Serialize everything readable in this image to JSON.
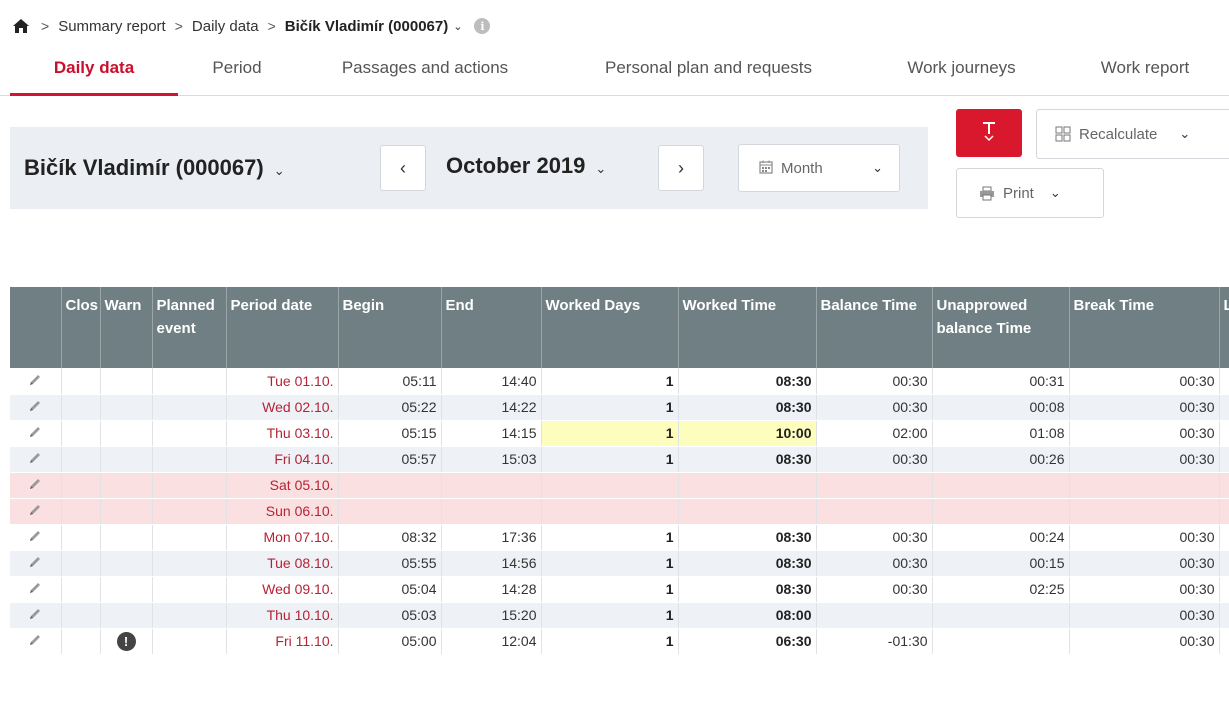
{
  "breadcrumb": {
    "items": [
      "Summary report",
      "Daily data"
    ],
    "current": "Bičík Vladimír (000067)",
    "info_glyph": "i"
  },
  "tabs": [
    {
      "label": "Daily data",
      "active": true
    },
    {
      "label": "Period",
      "active": false
    },
    {
      "label": "Passages and actions",
      "active": false
    },
    {
      "label": "Personal plan and requests",
      "active": false
    },
    {
      "label": "Work journeys",
      "active": false
    },
    {
      "label": "Work report",
      "active": false
    }
  ],
  "selector": {
    "employee": "Bičík Vladimír (000067)",
    "month": "October 2019",
    "period_type": "Month"
  },
  "toolbar": {
    "recalculate_label": "Recalculate",
    "print_label": "Print"
  },
  "colors": {
    "accent": "#d9182e",
    "header_bg": "#707f83",
    "date_text": "#b52335",
    "weekend_row": "#fbe0e2",
    "highlight": "#fdfdbd"
  },
  "icons": {
    "home": "home-icon",
    "info": "info-icon",
    "text_tool": "text-tool-icon",
    "recalculate": "grid-icon",
    "print": "printer-icon",
    "calendar": "calendar-icon",
    "edit": "pencil-icon",
    "warning": "exclamation-icon"
  },
  "table": {
    "columns": {
      "edit": "",
      "close": "Clos",
      "warn": "Warn",
      "planned": "Planned event",
      "date": "Period date",
      "begin": "Begin",
      "end": "End",
      "worked_days": "Worked Days",
      "worked_time": "Worked Time",
      "balance": "Balance Time",
      "unapproved": "Unapprowed balance Time",
      "break": "Break Time",
      "extra": "L"
    },
    "rows": [
      {
        "date": "Tue 01.10.",
        "begin": "05:11",
        "end": "14:40",
        "worked_days": "1",
        "worked_time": "08:30",
        "balance": "00:30",
        "unapproved": "00:31",
        "break": "00:30",
        "weekend": false,
        "highlight": false,
        "warning": ""
      },
      {
        "date": "Wed 02.10.",
        "begin": "05:22",
        "end": "14:22",
        "worked_days": "1",
        "worked_time": "08:30",
        "balance": "00:30",
        "unapproved": "00:08",
        "break": "00:30",
        "weekend": false,
        "highlight": false,
        "warning": ""
      },
      {
        "date": "Thu 03.10.",
        "begin": "05:15",
        "end": "14:15",
        "worked_days": "1",
        "worked_time": "10:00",
        "balance": "02:00",
        "unapproved": "01:08",
        "break": "00:30",
        "weekend": false,
        "highlight": true,
        "warning": ""
      },
      {
        "date": "Fri 04.10.",
        "begin": "05:57",
        "end": "15:03",
        "worked_days": "1",
        "worked_time": "08:30",
        "balance": "00:30",
        "unapproved": "00:26",
        "break": "00:30",
        "weekend": false,
        "highlight": false,
        "warning": ""
      },
      {
        "date": "Sat 05.10.",
        "begin": "",
        "end": "",
        "worked_days": "",
        "worked_time": "",
        "balance": "",
        "unapproved": "",
        "break": "",
        "weekend": true,
        "highlight": false,
        "warning": ""
      },
      {
        "date": "Sun 06.10.",
        "begin": "",
        "end": "",
        "worked_days": "",
        "worked_time": "",
        "balance": "",
        "unapproved": "",
        "break": "",
        "weekend": true,
        "highlight": false,
        "warning": ""
      },
      {
        "date": "Mon 07.10.",
        "begin": "08:32",
        "end": "17:36",
        "worked_days": "1",
        "worked_time": "08:30",
        "balance": "00:30",
        "unapproved": "00:24",
        "break": "00:30",
        "weekend": false,
        "highlight": false,
        "warning": ""
      },
      {
        "date": "Tue 08.10.",
        "begin": "05:55",
        "end": "14:56",
        "worked_days": "1",
        "worked_time": "08:30",
        "balance": "00:30",
        "unapproved": "00:15",
        "break": "00:30",
        "weekend": false,
        "highlight": false,
        "warning": ""
      },
      {
        "date": "Wed 09.10.",
        "begin": "05:04",
        "end": "14:28",
        "worked_days": "1",
        "worked_time": "08:30",
        "balance": "00:30",
        "unapproved": "02:25",
        "break": "00:30",
        "weekend": false,
        "highlight": false,
        "warning": ""
      },
      {
        "date": "Thu 10.10.",
        "begin": "05:03",
        "end": "15:20",
        "worked_days": "1",
        "worked_time": "08:00",
        "balance": "",
        "unapproved": "",
        "break": "00:30",
        "weekend": false,
        "highlight": false,
        "warning": ""
      },
      {
        "date": "Fri 11.10.",
        "begin": "05:00",
        "end": "12:04",
        "worked_days": "1",
        "worked_time": "06:30",
        "balance": "-01:30",
        "unapproved": "",
        "break": "00:30",
        "weekend": false,
        "highlight": false,
        "warning": "!"
      }
    ]
  }
}
